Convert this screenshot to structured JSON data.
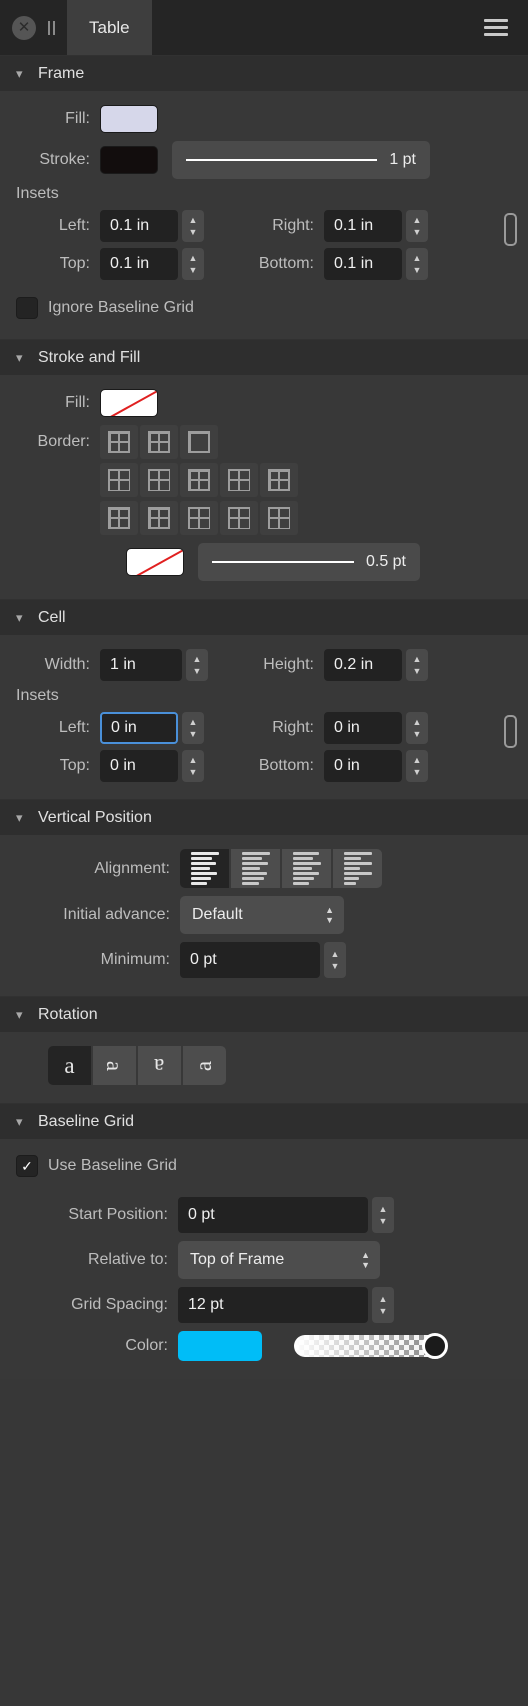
{
  "titlebar": {
    "close_label": "✕",
    "tab_label": "Table"
  },
  "sections": {
    "frame": {
      "title": "Frame",
      "fill_label": "Fill:",
      "fill_color": "#d6d7ea",
      "stroke_label": "Stroke:",
      "stroke_color": "#120d0d",
      "stroke_width": "1 pt",
      "insets_title": "Insets",
      "left_label": "Left:",
      "left_value": "0.1 in",
      "right_label": "Right:",
      "right_value": "0.1 in",
      "top_label": "Top:",
      "top_value": "0.1 in",
      "bottom_label": "Bottom:",
      "bottom_value": "0.1 in",
      "ignore_baseline_label": "Ignore Baseline Grid",
      "ignore_baseline_checked": false
    },
    "stroke_and_fill": {
      "title": "Stroke and Fill",
      "fill_label": "Fill:",
      "fill_value": "none",
      "border_label": "Border:",
      "border_color_value": "none",
      "border_width": "0.5 pt",
      "border_styles_row1": [
        "all-borders",
        "outer-and-inner",
        "outer-only"
      ],
      "border_styles_row2": [
        "inner-horizontal",
        "inner-vertical",
        "top-emphasis",
        "middle-emphasis",
        "bottom-emphasis"
      ],
      "border_styles_row3": [
        "left-emphasis",
        "right-emphasis",
        "no-bottom",
        "no-top",
        "vertical-only"
      ]
    },
    "cell": {
      "title": "Cell",
      "width_label": "Width:",
      "width_value": "1 in",
      "height_label": "Height:",
      "height_value": "0.2 in",
      "insets_title": "Insets",
      "left_label": "Left:",
      "left_value": "0 in",
      "right_label": "Right:",
      "right_value": "0 in",
      "top_label": "Top:",
      "top_value": "0 in",
      "bottom_label": "Bottom:",
      "bottom_value": "0 in"
    },
    "vertical_position": {
      "title": "Vertical Position",
      "alignment_label": "Alignment:",
      "alignment_options": [
        "top",
        "center",
        "bottom",
        "justify"
      ],
      "alignment_selected": 0,
      "initial_advance_label": "Initial advance:",
      "initial_advance_value": "Default",
      "minimum_label": "Minimum:",
      "minimum_value": "0 pt"
    },
    "rotation": {
      "title": "Rotation",
      "options": [
        "0°",
        "90°",
        "180°",
        "270°"
      ],
      "glyph": "a",
      "selected": 0
    },
    "baseline_grid": {
      "title": "Baseline Grid",
      "use_label": "Use Baseline Grid",
      "use_checked": true,
      "check_glyph": "✓",
      "start_position_label": "Start Position:",
      "start_position_value": "0 pt",
      "relative_to_label": "Relative to:",
      "relative_to_value": "Top of Frame",
      "grid_spacing_label": "Grid Spacing:",
      "grid_spacing_value": "12 pt",
      "color_label": "Color:",
      "color_value": "#00bdf7",
      "opacity": 100
    }
  }
}
